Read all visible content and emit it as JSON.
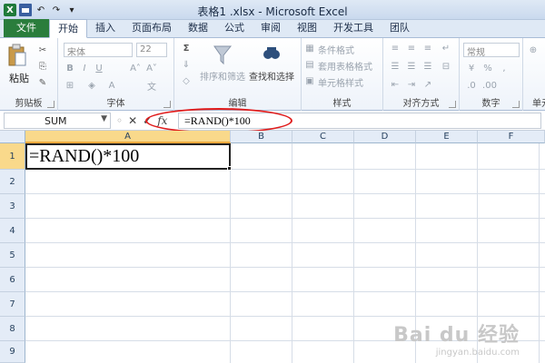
{
  "window": {
    "title": "表格1 .xlsx - Microsoft Excel"
  },
  "tabs": [
    {
      "label": "文件",
      "kind": "file"
    },
    {
      "label": "开始",
      "kind": "active"
    },
    {
      "label": "插入"
    },
    {
      "label": "页面布局"
    },
    {
      "label": "数据"
    },
    {
      "label": "公式"
    },
    {
      "label": "审阅"
    },
    {
      "label": "视图"
    },
    {
      "label": "开发工具"
    },
    {
      "label": "团队"
    }
  ],
  "ribbon": {
    "clipboard": {
      "paste": "粘贴",
      "label": "剪贴板"
    },
    "font": {
      "name": "宋体",
      "size": "22",
      "label": "字体"
    },
    "editing": {
      "sort_filter": "排序和筛选",
      "find_select": "查找和选择",
      "label": "编辑"
    },
    "styles": {
      "conditional": "条件格式",
      "table": "套用表格格式",
      "cell": "单元格样式",
      "label": "样式"
    },
    "alignment": {
      "label": "对齐方式"
    },
    "number": {
      "format": "常规",
      "label": "数字"
    },
    "cells": {
      "label": "单元"
    }
  },
  "formula_bar": {
    "name_box": "SUM",
    "formula": "=RAND()*100"
  },
  "grid": {
    "columns": [
      "A",
      "B",
      "C",
      "D",
      "E",
      "F"
    ],
    "rows": [
      "1",
      "2",
      "3",
      "4",
      "5",
      "6",
      "7",
      "8",
      "9"
    ],
    "active_cell_text": "=RAND()*100"
  },
  "watermark": {
    "main": "Bai du 经验",
    "sub": "jingyan.baidu.com"
  },
  "colors": {
    "accent_file_tab": "#2a7d3c",
    "highlight": "#e01b1b",
    "selected_header": "#f9d98b"
  }
}
